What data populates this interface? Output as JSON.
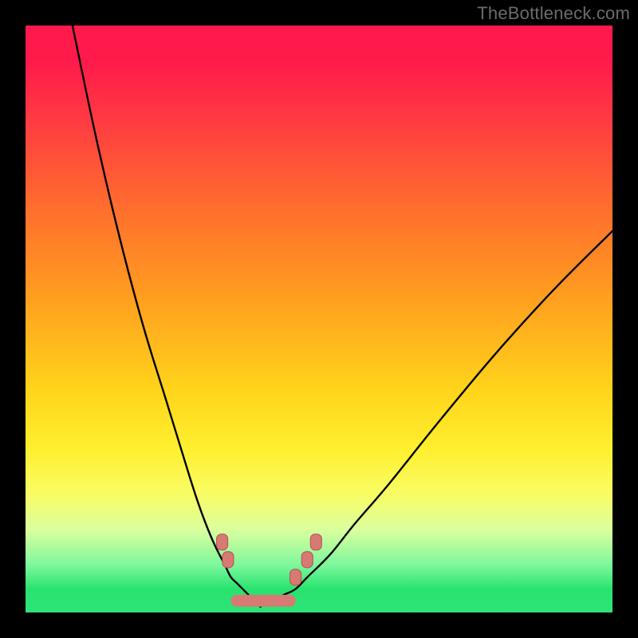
{
  "watermark": "TheBottleneck.com",
  "colors": {
    "page_bg": "#000000",
    "curve": "#000000",
    "marker_fill": "#d77a74",
    "marker_stroke": "#b85b56",
    "gradient_top": "#ff1a4b",
    "gradient_bottom": "#2ee37a"
  },
  "chart_data": {
    "type": "line",
    "title": "",
    "xlabel": "",
    "ylabel": "",
    "xlim": [
      0,
      100
    ],
    "ylim": [
      0,
      100
    ],
    "grid": false,
    "legend": false,
    "series": [
      {
        "name": "left-curve",
        "x": [
          8,
          12,
          16,
          20,
          24,
          28,
          30,
          32,
          34,
          35,
          36,
          37,
          38,
          39,
          40
        ],
        "y": [
          100,
          81,
          64,
          49,
          36,
          23,
          17,
          12,
          8,
          6,
          5,
          4,
          3,
          2,
          1
        ]
      },
      {
        "name": "right-curve",
        "x": [
          40,
          42,
          44,
          46,
          48,
          52,
          56,
          62,
          70,
          80,
          90,
          100
        ],
        "y": [
          1,
          2,
          3,
          4,
          6,
          10,
          15,
          22,
          32,
          44,
          55,
          65
        ]
      },
      {
        "name": "bottom-flat",
        "x": [
          36,
          37,
          38,
          39,
          40,
          41,
          42,
          43,
          44,
          45
        ],
        "y": [
          2,
          1.5,
          1.2,
          1.1,
          1.0,
          1.05,
          1.1,
          1.3,
          1.6,
          2
        ]
      }
    ],
    "markers": [
      {
        "x": 33.5,
        "y": 12
      },
      {
        "x": 34.5,
        "y": 9
      },
      {
        "x": 46.0,
        "y": 6
      },
      {
        "x": 48.0,
        "y": 9
      },
      {
        "x": 49.5,
        "y": 12
      }
    ],
    "bottom_segment": {
      "x0": 36,
      "x1": 45,
      "y": 2
    }
  }
}
